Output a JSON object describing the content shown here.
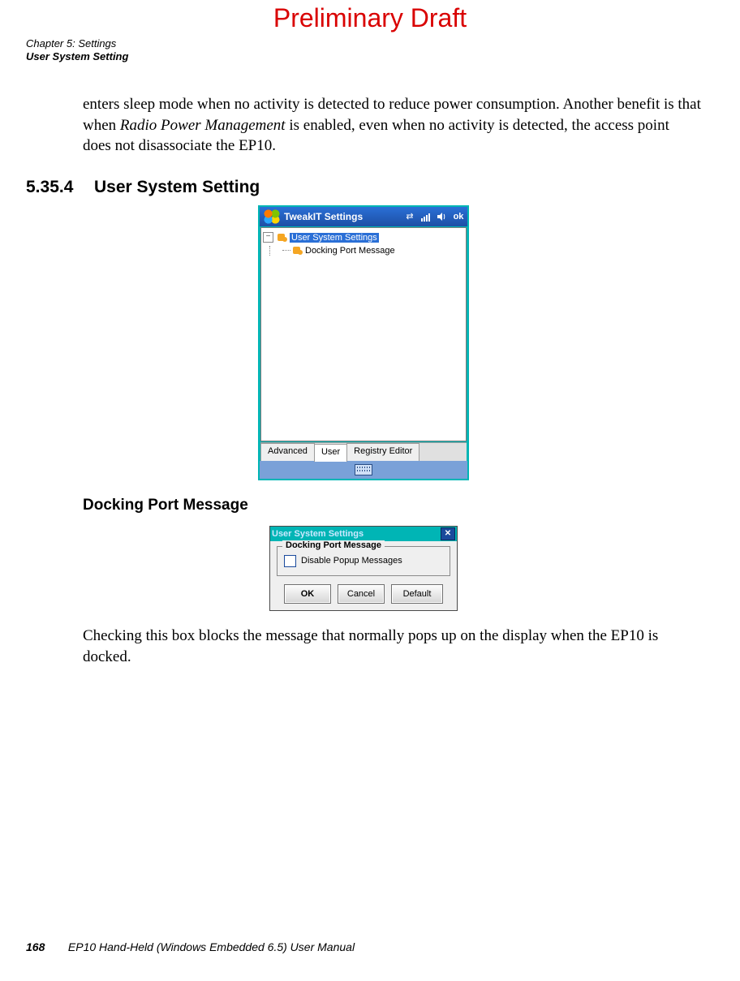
{
  "banner": "Preliminary Draft",
  "header": {
    "line1": "Chapter 5: Settings",
    "line2": "User System Setting"
  },
  "paragraphs": {
    "intro": "enters sleep mode when no activity is detected to reduce power consumption. Another benefit is that when Radio Power Management is enabled, even when no activity is de­tected, the access point does not disassociate the EP10.",
    "closing": "Checking this box blocks the message that normally pops up on the display when the EP10 is docked."
  },
  "section": {
    "number": "5.35.4",
    "title": "User System Setting",
    "subheading": "Docking Port Message"
  },
  "screenshot1": {
    "window_title": "TweakIT Settings",
    "status_ok": "ok",
    "tree": {
      "root": "User System Settings",
      "child": "Docking Port Message"
    },
    "tabs": [
      "Advanced",
      "User",
      "Registry Editor"
    ],
    "active_tab_index": 1
  },
  "screenshot2": {
    "title": "User System Settings",
    "group_label": "Docking Port Message",
    "checkbox_label": "Disable Popup Messages",
    "buttons": {
      "ok": "OK",
      "cancel": "Cancel",
      "default": "Default"
    }
  },
  "footer": {
    "page": "168",
    "book": "EP10 Hand-Held (Windows Embedded 6.5) User Manual"
  }
}
